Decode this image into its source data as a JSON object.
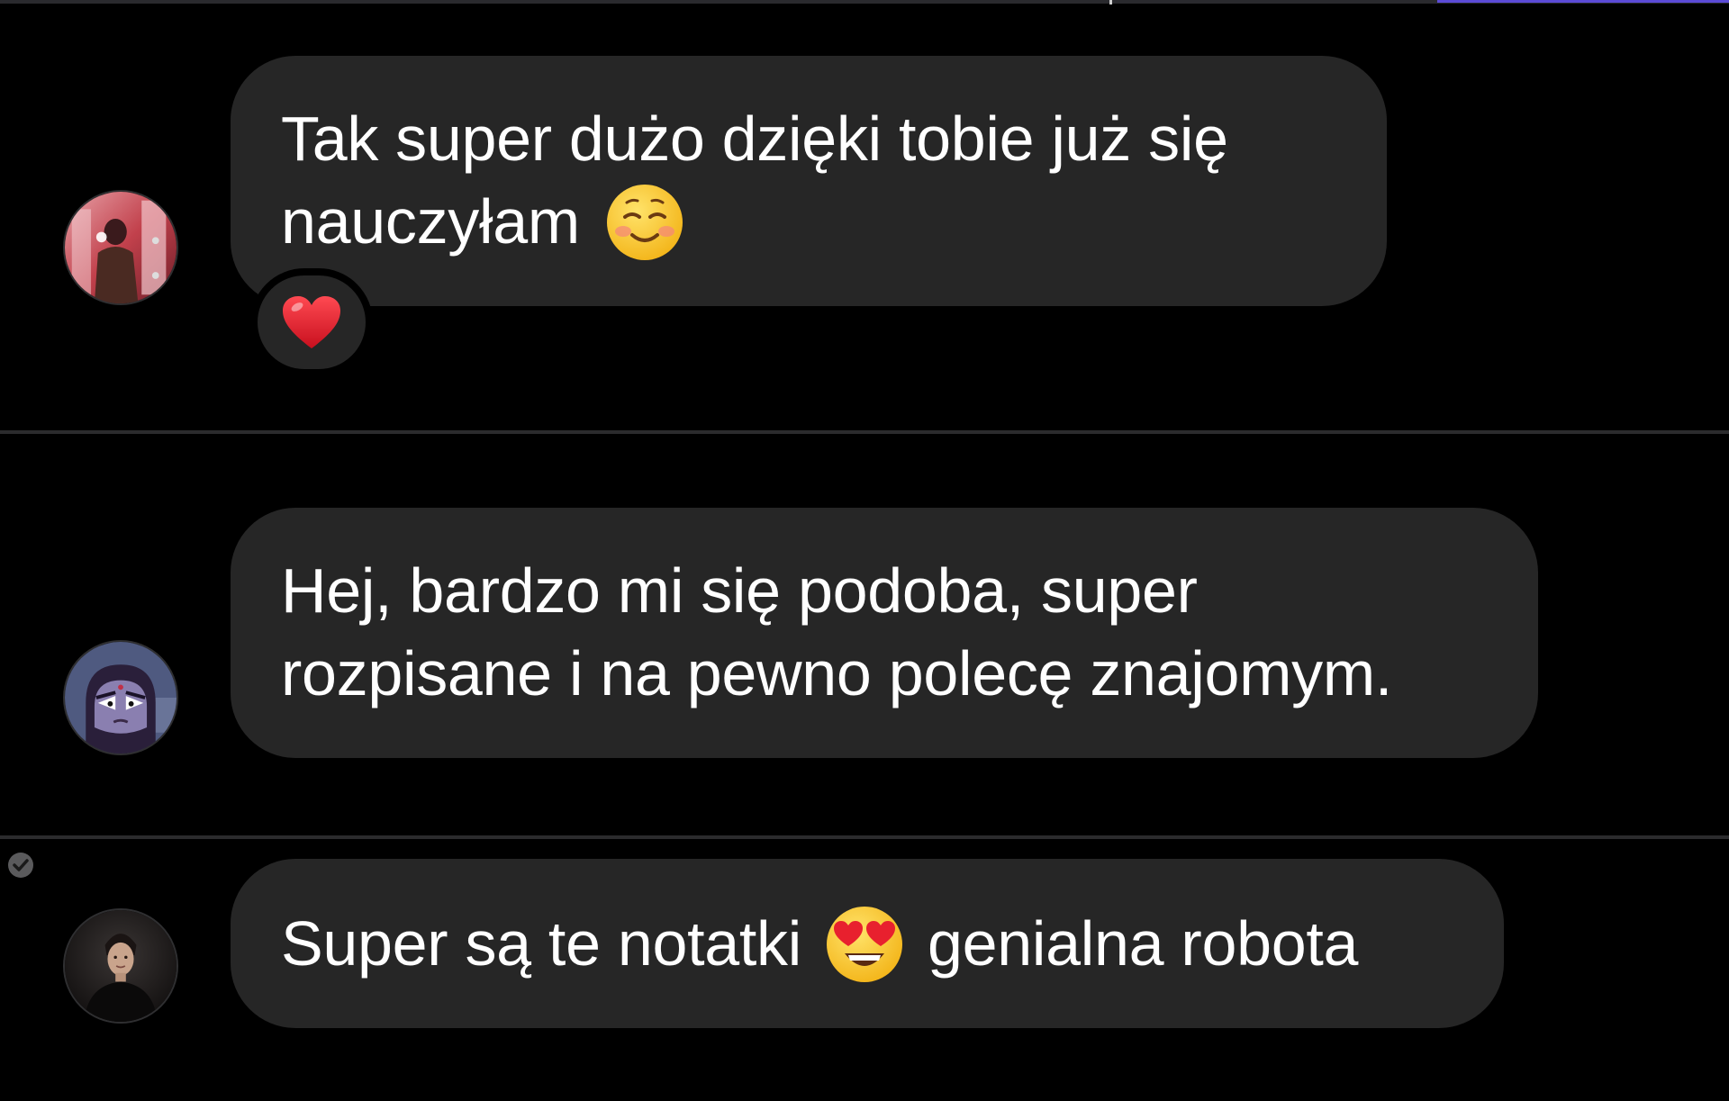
{
  "messages": [
    {
      "lines": [
        "Tak super dużo dzięki tobie już się",
        "nauczyłam"
      ],
      "trailing_emoji": "smiling-face-icon",
      "reaction": "red-heart-icon",
      "avatar": "avatar-user-1"
    },
    {
      "lines": [
        "Hej, bardzo mi się podoba, super",
        "rozpisane i na pewno polecę znajomym."
      ],
      "avatar": "avatar-user-2"
    },
    {
      "text_before_emoji": "Super są te notatki",
      "inline_emoji": "heart-eyes-icon",
      "text_after_emoji": "genialna robota",
      "avatar": "avatar-user-3",
      "status_icon": "check-circle-icon"
    }
  ],
  "colors": {
    "background": "#000000",
    "bubble": "#262626",
    "text": "#ffffff",
    "divider": "#2b2b2d",
    "heart": "#e0202e"
  }
}
